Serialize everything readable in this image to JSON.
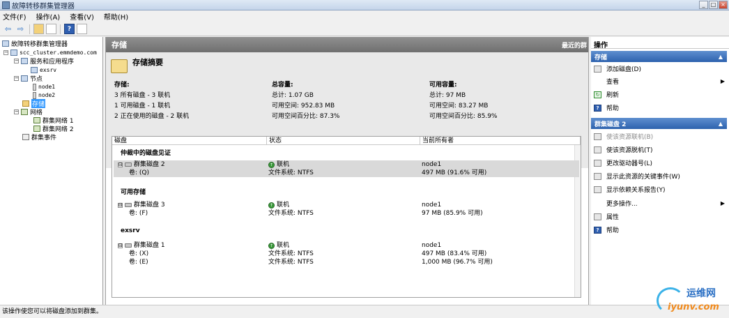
{
  "window": {
    "title": "故障转移群集管理器",
    "buttons": [
      "_",
      "□",
      "×"
    ]
  },
  "menubar": [
    "文件(F)",
    "操作(A)",
    "查看(V)",
    "帮助(H)"
  ],
  "toolbar": {
    "back": "⇦",
    "forward": "⇨",
    "help": "?"
  },
  "tree": {
    "root": "故障转移群集管理器",
    "cluster": "scc_cluster.emmdemo.com",
    "services": "服务和应用程序",
    "service_item": "exsrv",
    "nodes": "节点",
    "node1": "node1",
    "node2": "node2",
    "storage": "存储",
    "networks": "网络",
    "net1": "群集网络 1",
    "net2": "群集网络 2",
    "events": "群集事件"
  },
  "center": {
    "header": "存储",
    "header_right": "最近的群",
    "summary_title": "存储摘要",
    "storage_col": {
      "title": "存储:",
      "l1": "3 所有磁盘 - 3 联机",
      "l2": "1 可用磁盘 - 1 联机",
      "l3": "2 正在使用的磁盘 - 2 联机"
    },
    "total_col": {
      "title": "总容量:",
      "l1": "总计: 1.07 GB",
      "l2": "可用空间: 952.83 MB",
      "l3": "可用空间百分比: 87.3%"
    },
    "avail_col": {
      "title": "可用容量:",
      "l1": "总计: 97 MB",
      "l2": "可用空间: 83.27 MB",
      "l3": "可用空间百分比: 85.9%"
    },
    "grid": {
      "headers": [
        "磁盘",
        "状态",
        "当前所有者"
      ],
      "group1": "仲裁中的磁盘见证",
      "group2": "可用存储",
      "group3": "exsrv",
      "expand": "⊟",
      "online_label": "联机",
      "online_mark": "↑",
      "rows": [
        {
          "disk": "群集磁盘 2",
          "status": "联机",
          "owner": "node1"
        },
        {
          "disk": "卷: (Q)",
          "status": "文件系统: NTFS",
          "owner": "497 MB (91.6% 可用)"
        },
        {
          "disk": "群集磁盘 3",
          "status": "联机",
          "owner": "node1"
        },
        {
          "disk": "卷: (F)",
          "status": "文件系统: NTFS",
          "owner": "97 MB (85.9% 可用)"
        },
        {
          "disk": "群集磁盘 1",
          "status": "联机",
          "owner": "node1"
        },
        {
          "disk": "卷: (X)",
          "status": "文件系统: NTFS",
          "owner": "497 MB (83.4% 可用)"
        },
        {
          "disk": "卷: (E)",
          "status": "文件系统: NTFS",
          "owner": "1,000 MB (96.7% 可用)"
        }
      ]
    }
  },
  "actions": {
    "title": "操作",
    "section1": "存储",
    "section2": "群集磁盘 2",
    "collapse": "▲",
    "arrow": "▶",
    "s1_items": [
      "添加磁盘(D)",
      "查看",
      "刷新",
      "帮助"
    ],
    "s2_items": [
      "使该资源联机(B)",
      "使该资源脱机(T)",
      "更改驱动器号(L)",
      "显示此资源的关键事件(W)",
      "显示依赖关系报告(Y)",
      "更多操作...",
      "属性",
      "帮助"
    ]
  },
  "status_text": "该操作使您可以将磁盘添加到群集。",
  "watermark": {
    "line1": "运维网",
    "line2": "iyunv.com"
  }
}
